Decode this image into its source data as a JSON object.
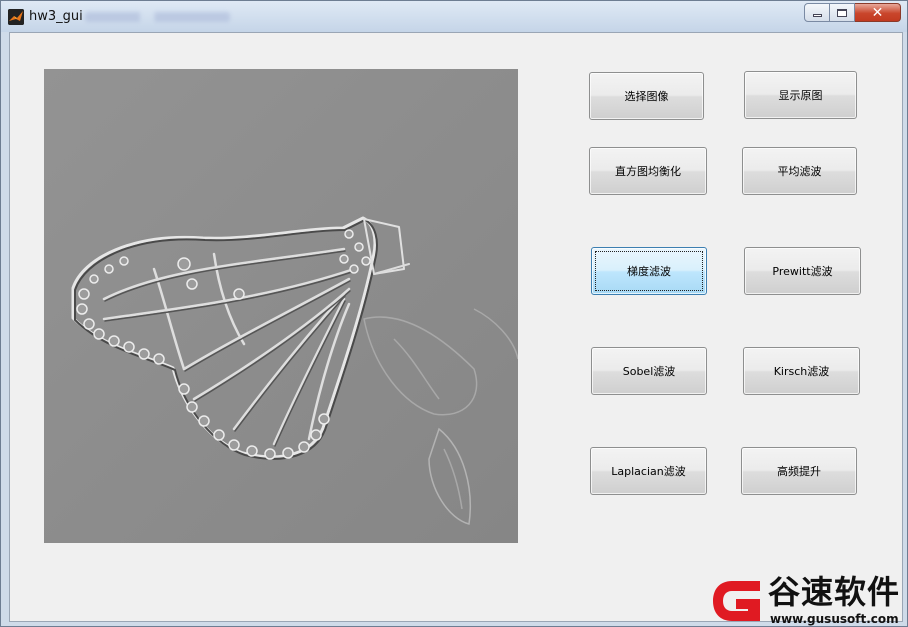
{
  "window": {
    "title": "hw3_gui",
    "icon": "matlab-icon",
    "controls": {
      "minimize": "minimize-icon",
      "maximize": "maximize-icon",
      "close": "close-icon",
      "close_glyph": "✕"
    }
  },
  "image_panel": {
    "content": "embossed-butterfly-image"
  },
  "buttons": {
    "select_image": "选择图像",
    "show_original": "显示原图",
    "histogram_eq": "直方图均衡化",
    "mean_filter": "平均滤波",
    "gradient_filter": "梯度滤波",
    "prewitt_filter": "Prewitt滤波",
    "sobel_filter": "Sobel滤波",
    "kirsch_filter": "Kirsch滤波",
    "laplacian_filter": "Laplacian滤波",
    "high_boost": "高频提升"
  },
  "watermark": {
    "title": "谷速软件",
    "url": "www.gususoft.com",
    "accent_color": "#e01a22"
  },
  "colors": {
    "client_bg": "#f0f0f0",
    "image_gray": "#8c8c8c",
    "focus_blue": "#bee6fd"
  }
}
